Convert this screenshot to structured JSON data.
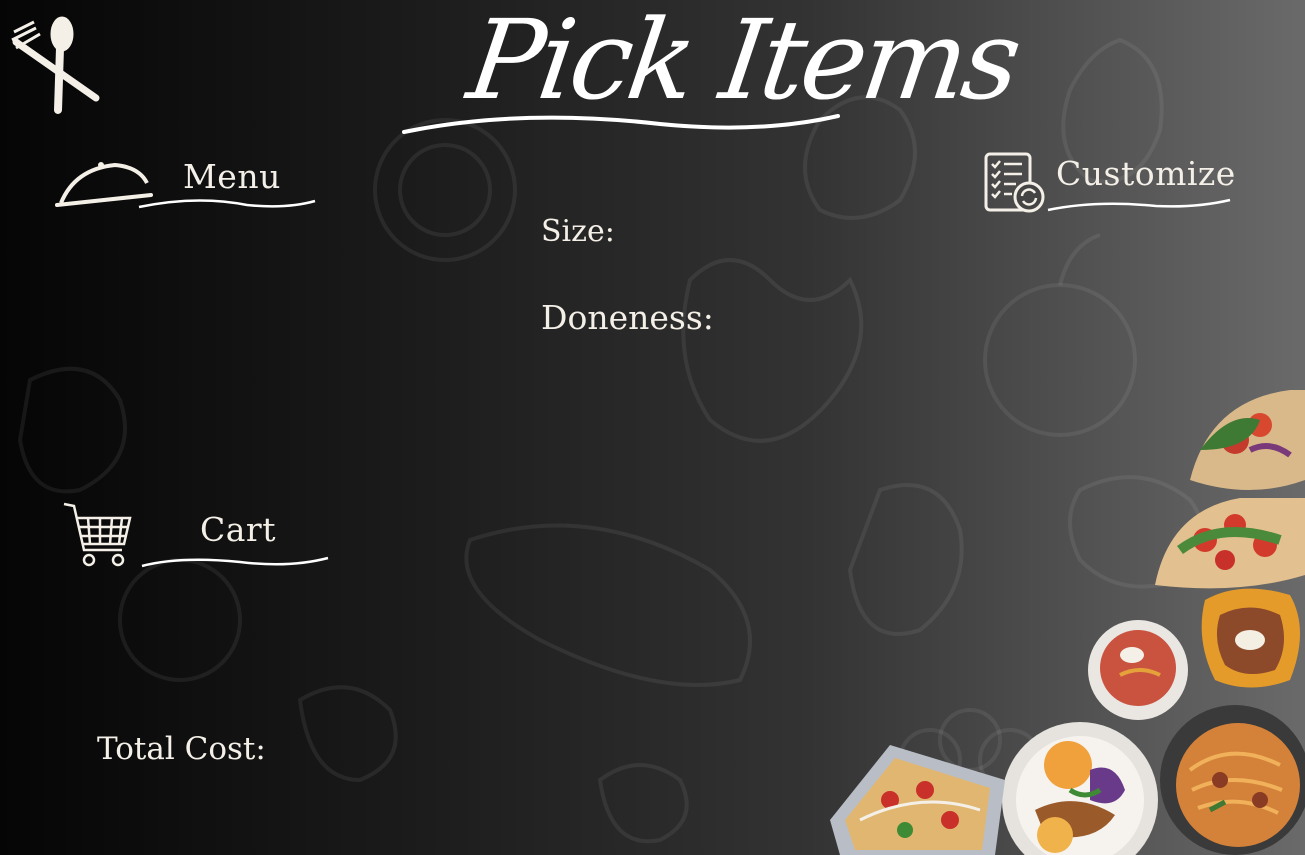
{
  "page": {
    "title": "Pick Items",
    "logo_icon": "fork-spoon-icon"
  },
  "sections": {
    "menu": {
      "label": "Menu",
      "icon": "cloche-icon"
    },
    "cart": {
      "label": "Cart",
      "icon": "shopping-cart-icon"
    },
    "customize": {
      "label": "Customize",
      "icon": "checklist-refresh-icon"
    }
  },
  "customize_fields": {
    "size_label": "Size:",
    "doneness_label": "Doneness:"
  },
  "cart_summary": {
    "total_cost_label": "Total Cost:"
  },
  "colors": {
    "text": "#f4f0e8",
    "background_dark": "#050505",
    "background_light": "#6a6a6a"
  }
}
